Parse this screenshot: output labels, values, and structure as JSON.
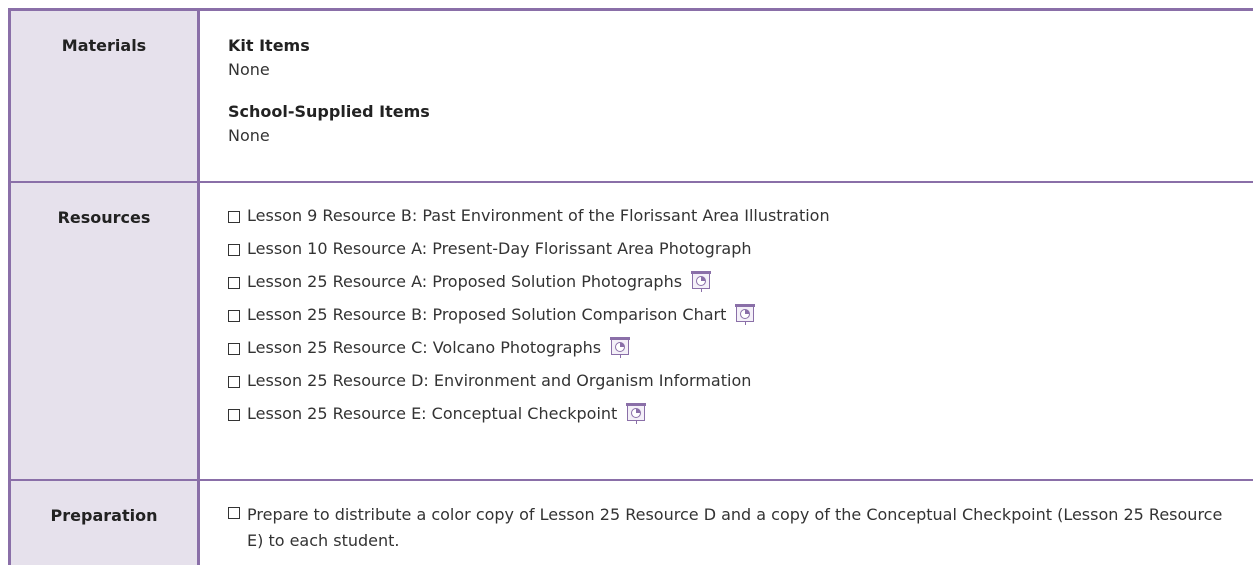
{
  "materials": {
    "label": "Materials",
    "kit_heading": "Kit Items",
    "kit_value": "None",
    "school_heading": "School-Supplied Items",
    "school_value": "None"
  },
  "resources": {
    "label": "Resources",
    "items": [
      {
        "text": "Lesson 9 Resource B: Past Environment of the Florissant Area Illustration",
        "projectable": false
      },
      {
        "text": "Lesson 10 Resource A: Present-Day Florissant Area Photograph",
        "projectable": false
      },
      {
        "text": "Lesson 25 Resource A: Proposed Solution Photographs",
        "projectable": true
      },
      {
        "text": "Lesson 25 Resource B: Proposed Solution Comparison Chart",
        "projectable": true
      },
      {
        "text": "Lesson 25 Resource C: Volcano Photographs",
        "projectable": true
      },
      {
        "text": "Lesson 25 Resource D: Environment and Organism Information",
        "projectable": false
      },
      {
        "text": "Lesson 25 Resource E: Conceptual Checkpoint",
        "projectable": true
      }
    ]
  },
  "preparation": {
    "label": "Preparation",
    "text": "Prepare to distribute a color copy of Lesson 25 Resource D and a copy of the Conceptual Checkpoint (Lesson 25 Resource E) to each student."
  },
  "colors": {
    "border": "#8a6fa8",
    "label_bg": "#e6e1ec"
  }
}
